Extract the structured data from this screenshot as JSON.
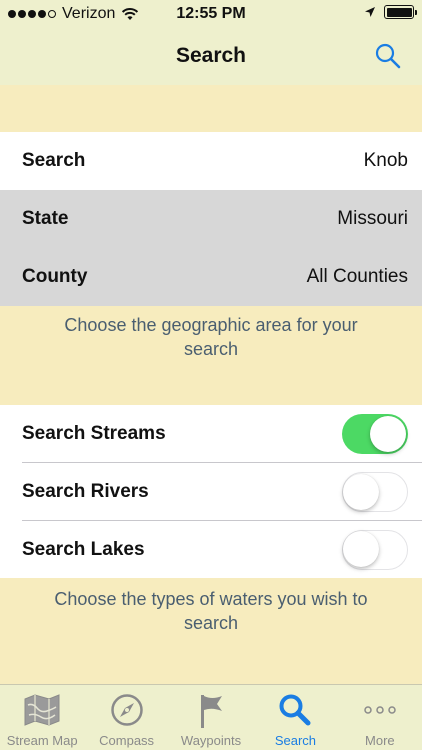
{
  "status_bar": {
    "carrier": "Verizon",
    "time": "12:55 PM",
    "signal_bars_filled": 4,
    "signal_bars_total": 5,
    "battery_level": 1.0
  },
  "nav": {
    "title": "Search",
    "search_icon": "magnifier-icon"
  },
  "area_section": {
    "rows": [
      {
        "label": "Search",
        "value": "Knob"
      },
      {
        "label": "State",
        "value": "Missouri"
      },
      {
        "label": "County",
        "value": "All Counties"
      }
    ],
    "footer": "Choose the geographic area for your search"
  },
  "water_section": {
    "rows": [
      {
        "label": "Search Streams",
        "on": true
      },
      {
        "label": "Search Rivers",
        "on": false
      },
      {
        "label": "Search Lakes",
        "on": false
      }
    ],
    "footer": "Choose the types of waters you wish to search"
  },
  "tabs": [
    {
      "label": "Stream Map",
      "icon": "map-icon",
      "active": false
    },
    {
      "label": "Compass",
      "icon": "compass-icon",
      "active": false
    },
    {
      "label": "Waypoints",
      "icon": "flag-icon",
      "active": false
    },
    {
      "label": "Search",
      "icon": "search-icon",
      "active": true
    },
    {
      "label": "More",
      "icon": "more-icon",
      "active": false
    }
  ],
  "colors": {
    "toggle_on": "#4cd964",
    "tab_active": "#1a7de3",
    "tab_inactive": "#8a8a8a",
    "bar_background": "#eef0cd",
    "page_background": "#f7ecbe"
  }
}
